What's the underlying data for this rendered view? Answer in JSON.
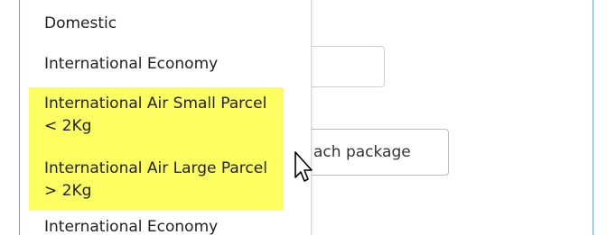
{
  "dropdown": {
    "options": [
      {
        "label": "Domestic"
      },
      {
        "label": "International Economy"
      },
      {
        "label": "International Air Small Parcel < 2Kg",
        "highlighted": true
      },
      {
        "label": "International Air Large Parcel > 2Kg",
        "highlighted": true
      },
      {
        "label": "International Economy"
      }
    ],
    "highlight_color": "#fcfd61"
  },
  "page": {
    "attach_button_label": "ach package"
  },
  "cursor": {
    "icon": "mouse-pointer-icon"
  },
  "colors": {
    "frame_border": "#6d9fd4",
    "scroll_thumb": "#b0b0b0"
  }
}
